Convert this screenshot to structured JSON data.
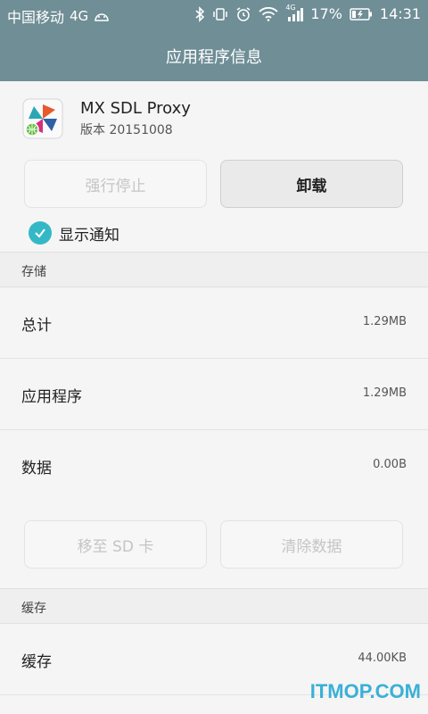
{
  "status_bar": {
    "carrier": "中国移动",
    "network": "4G",
    "signal_type": "4G",
    "battery_percent": "17%",
    "time": "14:31"
  },
  "header": {
    "title": "应用程序信息"
  },
  "app": {
    "name": "MX SDL Proxy",
    "version": "版本 20151008"
  },
  "actions": {
    "force_stop": "强行停止",
    "uninstall": "卸载"
  },
  "notifications": {
    "label": "显示通知",
    "checked": true
  },
  "storage": {
    "section_title": "存储",
    "rows": [
      {
        "label": "总计",
        "value": "1.29MB"
      },
      {
        "label": "应用程序",
        "value": "1.29MB"
      },
      {
        "label": "数据",
        "value": "0.00B"
      }
    ],
    "move_to_sd": "移至 SD 卡",
    "clear_data": "清除数据"
  },
  "cache": {
    "section_title": "缓存",
    "rows": [
      {
        "label": "缓存",
        "value": "44.00KB"
      }
    ]
  },
  "watermark": "ITMOP.COM",
  "colors": {
    "header": "#6f8e96",
    "accent": "#35b8c6"
  }
}
